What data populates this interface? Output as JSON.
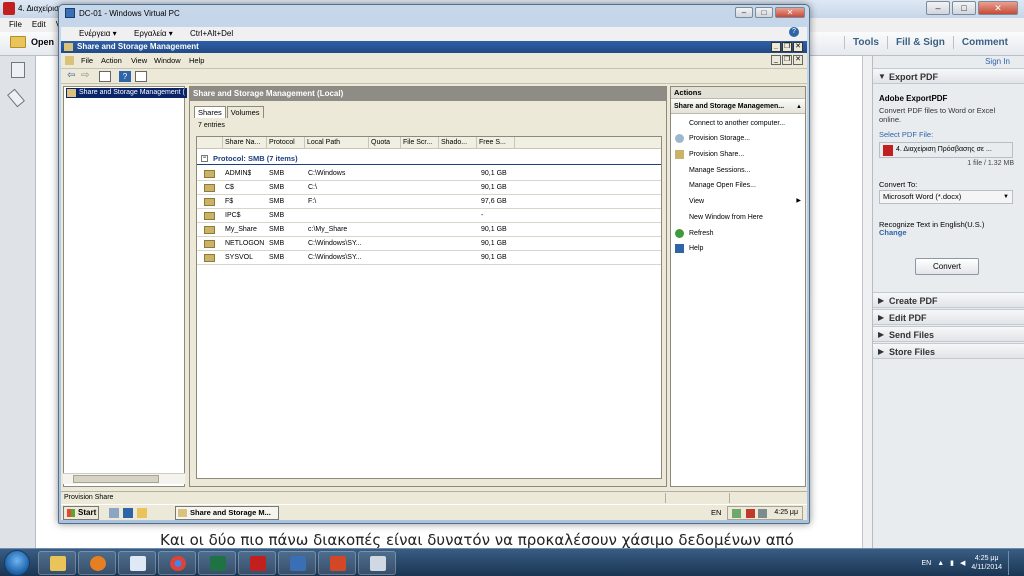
{
  "acrobat": {
    "title": "4. Διαχείριση",
    "menu": [
      "File",
      "Edit",
      "Vi"
    ],
    "open_label": "Open",
    "tabs": [
      "Tools",
      "Fill & Sign",
      "Comment"
    ],
    "sign_in": "Sign In",
    "doc_text": "Και οι δύο πιο πάνω διακοπές είναι δυνατόν να προκαλέσουν χάσιμο δεδομένων από",
    "panel": {
      "export_pdf": "Export PDF",
      "adobe_export_title": "Adobe ExportPDF",
      "adobe_export_desc": "Convert PDF files to Word or Excel online.",
      "select_pdf": "Select PDF File:",
      "file_name": "4. Διαχείριση Πρόσβασης σε ...",
      "file_count": "1 file / 1.32 MB",
      "convert_to": "Convert To:",
      "format": "Microsoft Word (*.docx)",
      "recognize": "Recognize Text in English(U.S.)",
      "change": "Change",
      "convert_button": "Convert",
      "create_pdf": "Create PDF",
      "edit_pdf": "Edit PDF",
      "send_files": "Send Files",
      "store_files": "Store Files"
    }
  },
  "vpc": {
    "title": "DC-01 - Windows Virtual PC",
    "menu": [
      "Ενέργεια ▾",
      "Εργαλεία ▾",
      "Ctrl+Alt+Del"
    ]
  },
  "mmc": {
    "title": "Share and Storage Management",
    "menu": [
      "File",
      "Action",
      "View",
      "Window",
      "Help"
    ],
    "tree_node": "Share and Storage Management (",
    "center_header": "Share and Storage Management (Local)",
    "tabs": [
      "Shares",
      "Volumes"
    ],
    "entries": "7 entries",
    "columns": [
      "Share Na...",
      "Protocol",
      "Local Path",
      "Quota",
      "File Scr...",
      "Shado...",
      "Free S..."
    ],
    "group": "Protocol: SMB (7 items)",
    "group_toggle": "−",
    "rows": [
      {
        "name": "ADMIN$",
        "protocol": "SMB",
        "path": "C:\\Windows",
        "free": "90,1 GB"
      },
      {
        "name": "C$",
        "protocol": "SMB",
        "path": "C:\\",
        "free": "90,1 GB"
      },
      {
        "name": "F$",
        "protocol": "SMB",
        "path": "F:\\",
        "free": "97,6 GB"
      },
      {
        "name": "IPC$",
        "protocol": "SMB",
        "path": "",
        "free": "-"
      },
      {
        "name": "My_Share",
        "protocol": "SMB",
        "path": "c:\\My_Share",
        "free": "90,1 GB"
      },
      {
        "name": "NETLOGON",
        "protocol": "SMB",
        "path": "C:\\Windows\\SY...",
        "free": "90,1 GB"
      },
      {
        "name": "SYSVOL",
        "protocol": "SMB",
        "path": "C:\\Windows\\SY...",
        "free": "90,1 GB"
      }
    ],
    "actions_header": "Actions",
    "actions_sub": "Share and Storage Managemen...",
    "actions": [
      {
        "label": "Connect to another computer...",
        "icon": ""
      },
      {
        "label": "Provision Storage...",
        "icon": "storage"
      },
      {
        "label": "Provision Share...",
        "icon": "share"
      },
      {
        "label": "Manage Sessions...",
        "icon": ""
      },
      {
        "label": "Manage Open Files...",
        "icon": ""
      },
      {
        "label": "View",
        "icon": "",
        "submenu": true
      },
      {
        "label": "New Window from Here",
        "icon": ""
      },
      {
        "label": "Refresh",
        "icon": "refresh"
      },
      {
        "label": "Help",
        "icon": "help"
      }
    ],
    "status": "Provision Share"
  },
  "guest_taskbar": {
    "start": "Start",
    "task": "Share and Storage M...",
    "lang": "EN",
    "time": "4:25 μμ"
  },
  "host_taskbar": {
    "lang": "EN",
    "time": "4:25 μμ",
    "date": "4/11/2014"
  },
  "colors": {
    "mmc_title": "#2e5fa6",
    "selection": "#0a246a",
    "acrobat_link": "#2e64a8",
    "pdf_red": "#c21f1f"
  }
}
